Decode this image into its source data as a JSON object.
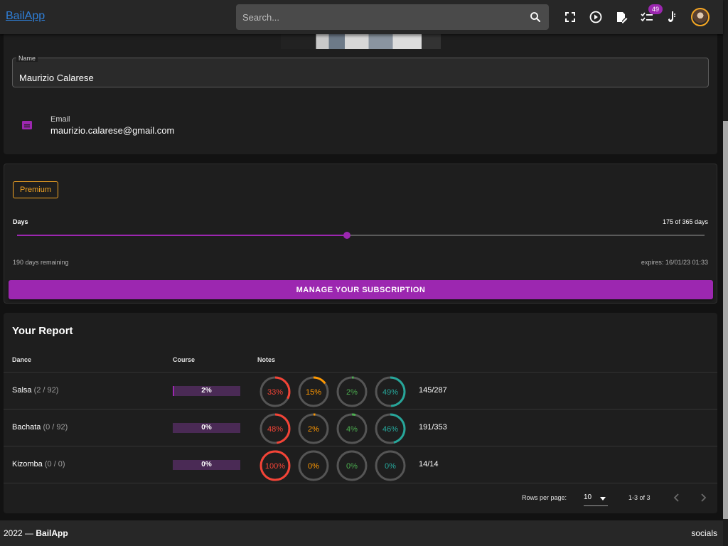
{
  "app": {
    "brand": "BailApp"
  },
  "search": {
    "placeholder": "Search..."
  },
  "toolbar": {
    "icons": [
      "fullscreen-icon",
      "play-circle-icon",
      "edit-note-icon",
      "checklist-icon",
      "saxophone-icon"
    ],
    "badge_count": "49"
  },
  "profile": {
    "name_label": "Name",
    "name_value": "Maurizio Calarese",
    "email_label": "Email",
    "email_value": "maurizio.calarese@gmail.com"
  },
  "subscription": {
    "plan": "Premium",
    "days_label": "Days",
    "days_count": "175 of 365 days",
    "days_used": 175,
    "days_total": 365,
    "remaining": "190 days remaining",
    "expires": "expires: 16/01/23 01:33",
    "manage_label": "MANAGE YOUR SUBSCRIPTION",
    "accent_color": "#9c27b0"
  },
  "report": {
    "title": "Your Report",
    "headers": {
      "dance": "Dance",
      "course": "Course",
      "notes": "Notes"
    },
    "rows": [
      {
        "dance": "Salsa",
        "count": "(2 / 92)",
        "course": "2%",
        "course_pct": 2,
        "notes": [
          {
            "label": "33%",
            "pct": 33,
            "color": "#f44336"
          },
          {
            "label": "15%",
            "pct": 15,
            "color": "#ff9800"
          },
          {
            "label": "2%",
            "pct": 2,
            "color": "#4caf50"
          },
          {
            "label": "49%",
            "pct": 49,
            "color": "#26a69a"
          }
        ],
        "total": "145/287"
      },
      {
        "dance": "Bachata",
        "count": "(0 / 92)",
        "course": "0%",
        "course_pct": 0,
        "notes": [
          {
            "label": "48%",
            "pct": 48,
            "color": "#f44336"
          },
          {
            "label": "2%",
            "pct": 2,
            "color": "#ff9800"
          },
          {
            "label": "4%",
            "pct": 4,
            "color": "#4caf50"
          },
          {
            "label": "46%",
            "pct": 46,
            "color": "#26a69a"
          }
        ],
        "total": "191/353"
      },
      {
        "dance": "Kizomba",
        "count": "(0 / 0)",
        "course": "0%",
        "course_pct": 0,
        "notes": [
          {
            "label": "100%",
            "pct": 100,
            "color": "#f44336"
          },
          {
            "label": "0%",
            "pct": 0,
            "color": "#ff9800"
          },
          {
            "label": "0%",
            "pct": 0,
            "color": "#4caf50"
          },
          {
            "label": "0%",
            "pct": 0,
            "color": "#26a69a"
          }
        ],
        "total": "14/14"
      }
    ],
    "pagination": {
      "rows_label": "Rows per page:",
      "rows_value": "10",
      "range": "1-3 of 3"
    }
  },
  "footer": {
    "year": "2022 —",
    "brand": "BailApp",
    "socials": "socials"
  }
}
